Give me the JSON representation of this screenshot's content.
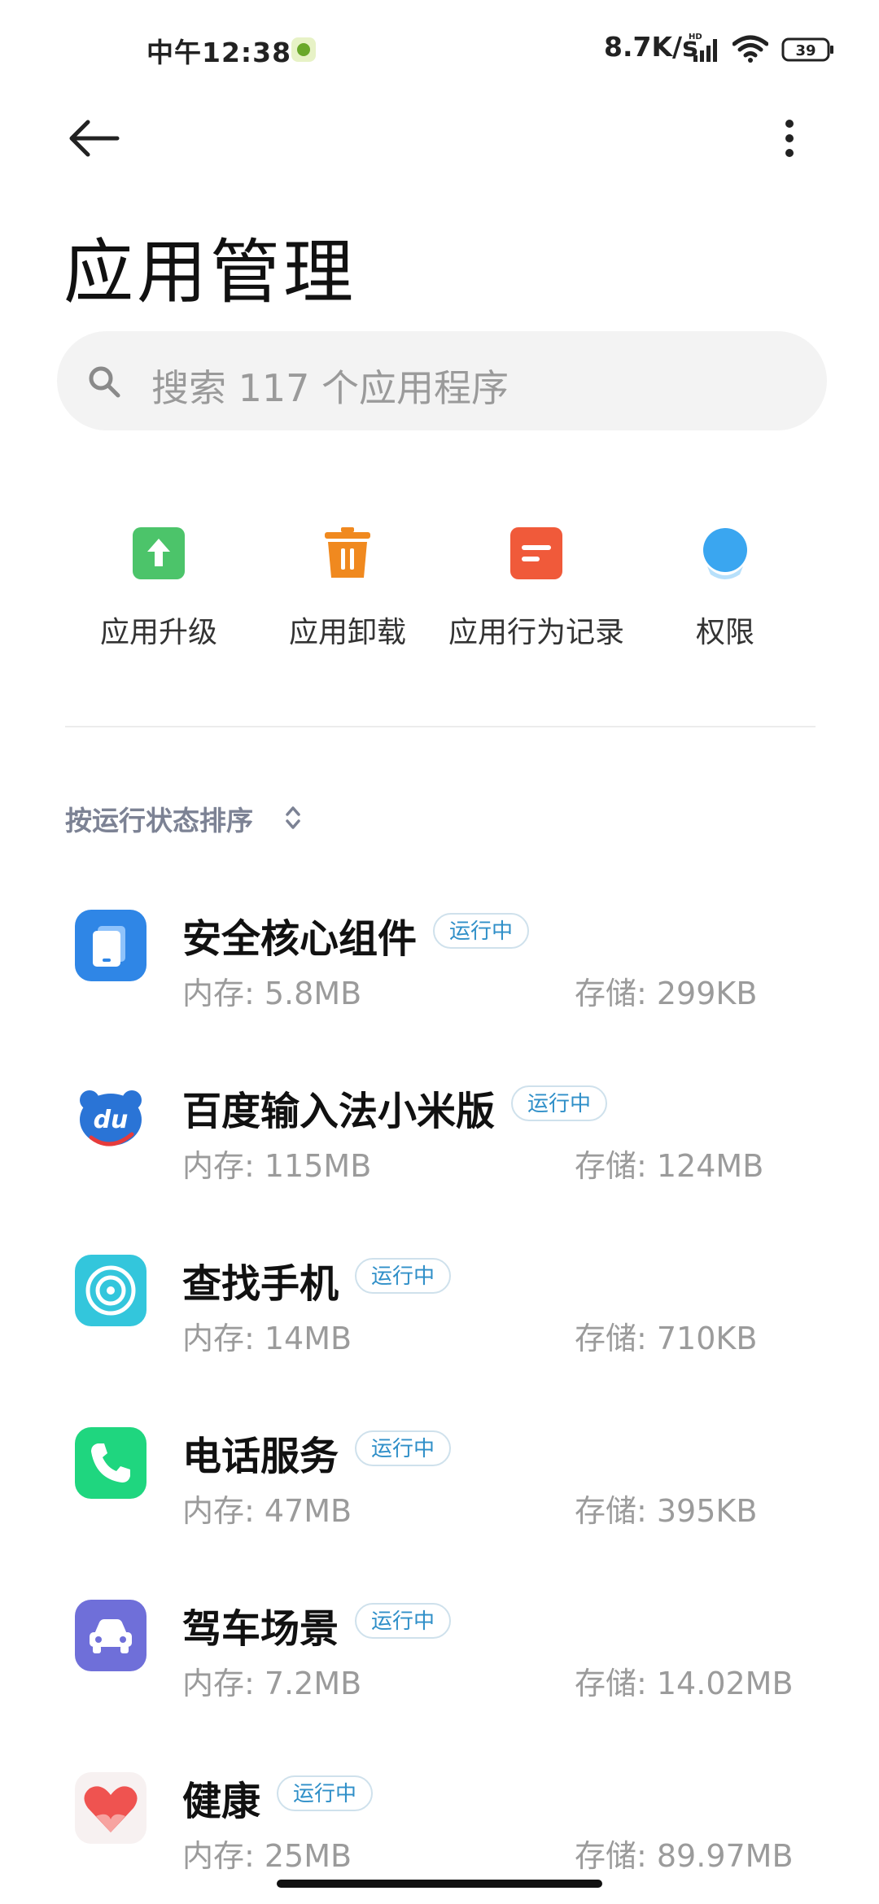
{
  "status_bar": {
    "time": "中午12:38",
    "network_speed": "8.7K/s",
    "battery": "39"
  },
  "header": {
    "title": "应用管理"
  },
  "search": {
    "placeholder": "搜索 117 个应用程序"
  },
  "quick_actions": [
    {
      "label": "应用升级",
      "icon": "upgrade-icon",
      "color": "#4cc46a"
    },
    {
      "label": "应用卸载",
      "icon": "trash-icon",
      "color": "#f0891f"
    },
    {
      "label": "应用行为记录",
      "icon": "record-icon",
      "color": "#f05a3a"
    },
    {
      "label": "权限",
      "icon": "permission-icon",
      "color": "#3aa6f0"
    }
  ],
  "sort": {
    "label": "按运行状态排序"
  },
  "apps": [
    {
      "name": "安全核心组件",
      "badge": "运行中",
      "memory": "内存: 5.8MB",
      "storage": "存储: 299KB",
      "icon": "security-core-icon"
    },
    {
      "name": "百度输入法小米版",
      "badge": "运行中",
      "memory": "内存: 115MB",
      "storage": "存储: 124MB",
      "icon": "baidu-input-icon"
    },
    {
      "name": "查找手机",
      "badge": "运行中",
      "memory": "内存: 14MB",
      "storage": "存储: 710KB",
      "icon": "find-phone-icon"
    },
    {
      "name": "电话服务",
      "badge": "运行中",
      "memory": "内存: 47MB",
      "storage": "存储: 395KB",
      "icon": "phone-service-icon"
    },
    {
      "name": "驾车场景",
      "badge": "运行中",
      "memory": "内存: 7.2MB",
      "storage": "存储: 14.02MB",
      "icon": "car-scene-icon"
    },
    {
      "name": "健康",
      "badge": "运行中",
      "memory": "内存: 25MB",
      "storage": "存储: 89.97MB",
      "icon": "health-icon"
    }
  ],
  "colors": {
    "badge_text": "#2f8fc8",
    "secondary_text": "#9b9b9b",
    "search_bg": "#f3f3f3"
  }
}
